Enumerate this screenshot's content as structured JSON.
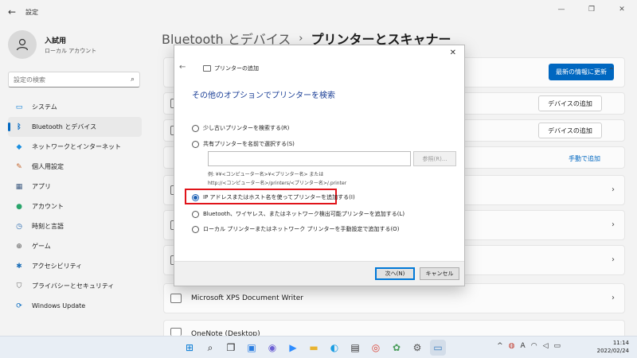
{
  "window": {
    "title": "設定"
  },
  "profile": {
    "name": "入試用",
    "account": "ローカル アカウント"
  },
  "search": {
    "placeholder": "設定の検索"
  },
  "sidebar": {
    "items": [
      {
        "label": "システム",
        "icon": "monitor-icon"
      },
      {
        "label": "Bluetooth とデバイス",
        "icon": "bluetooth-icon",
        "active": true
      },
      {
        "label": "ネットワークとインターネット",
        "icon": "wifi-icon"
      },
      {
        "label": "個人用設定",
        "icon": "brush-icon"
      },
      {
        "label": "アプリ",
        "icon": "apps-icon"
      },
      {
        "label": "アカウント",
        "icon": "person-icon"
      },
      {
        "label": "時刻と言語",
        "icon": "globe-clock-icon"
      },
      {
        "label": "ゲーム",
        "icon": "gamepad-icon"
      },
      {
        "label": "アクセシビリティ",
        "icon": "accessibility-icon"
      },
      {
        "label": "プライバシーとセキュリティ",
        "icon": "shield-icon"
      },
      {
        "label": "Windows Update",
        "icon": "update-icon"
      }
    ]
  },
  "header": {
    "crumb": "Bluetooth とデバイス",
    "separator": "›",
    "current": "プリンターとスキャナー"
  },
  "main": {
    "refresh_label": "最新の情報に更新",
    "add_device_label_1": "デバイスの追加",
    "add_device_label_2": "デバイスの追加",
    "manual_add_label": "手動で追加",
    "printers": [
      "Microsoft XPS Document Writer",
      "OneNote (Desktop)"
    ]
  },
  "dialog": {
    "title": "プリンターの追加",
    "heading": "その他のオプションでプリンターを検索",
    "options": [
      "少し古いプリンターを検索する(R)",
      "共有プリンターを名前で選択する(S)",
      "IP アドレスまたはホスト名を使ってプリンターを追加する(I)",
      "Bluetooth、ワイヤレス、またはネットワーク検出可能プリンターを追加する(L)",
      "ローカル プリンターまたはネットワーク プリンターを手動設定で追加する(O)"
    ],
    "selected_index": 2,
    "share_input_value": "",
    "browse_label": "参照(R)...",
    "example_line1": "例: ¥¥<コンピューター名>¥<プリンター名> または",
    "example_line2": "http://<コンピューター名>/printers/<プリンター名>/.printer",
    "next_label": "次へ(N)",
    "cancel_label": "キャンセル"
  },
  "taskbar": {
    "time": "11:14",
    "date": "2022/02/24"
  },
  "colors": {
    "accent": "#0067c0",
    "highlight": "#e0141a",
    "dialog_heading": "#1a3e96"
  }
}
